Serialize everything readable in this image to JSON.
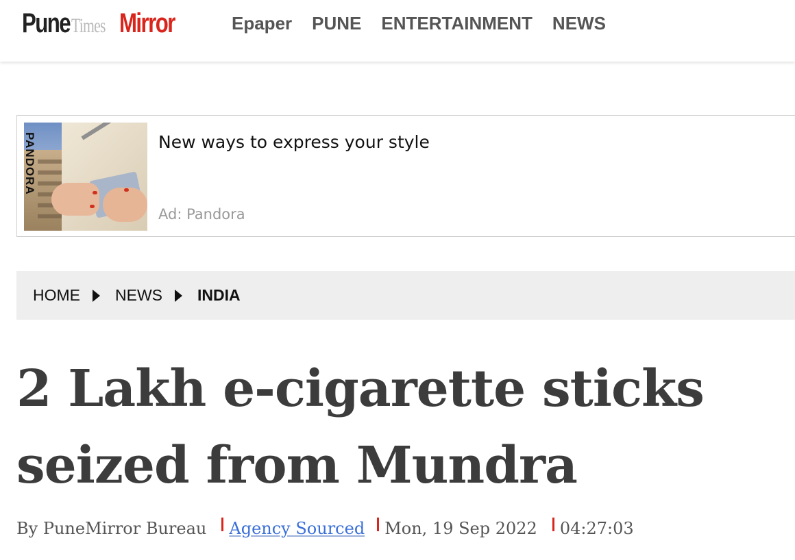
{
  "site": {
    "logo_pune": "Pune",
    "logo_times": "Times",
    "logo_mirror": "Mirror",
    "colors": {
      "brand_red": "#d9251c",
      "nav_text": "#555555",
      "link_blue": "#3a6fd8"
    }
  },
  "nav": {
    "items": [
      {
        "label": "Epaper"
      },
      {
        "label": "PUNE"
      },
      {
        "label": "ENTERTAINMENT"
      },
      {
        "label": "NEWS"
      }
    ]
  },
  "ad": {
    "brand_text": "PANDORA",
    "title": "New ways to express your style",
    "source": "Ad: Pandora"
  },
  "breadcrumb": {
    "items": [
      {
        "label": "HOME"
      },
      {
        "label": "NEWS"
      },
      {
        "label": "INDIA"
      }
    ],
    "separator_icon": "triangle-right-icon"
  },
  "article": {
    "headline": "2 Lakh e-cigarette sticks seized from Mundra",
    "author": "By PuneMirror Bureau",
    "source_link": "Agency Sourced",
    "date": "Mon, 19 Sep 2022",
    "time": "04:27:03"
  }
}
